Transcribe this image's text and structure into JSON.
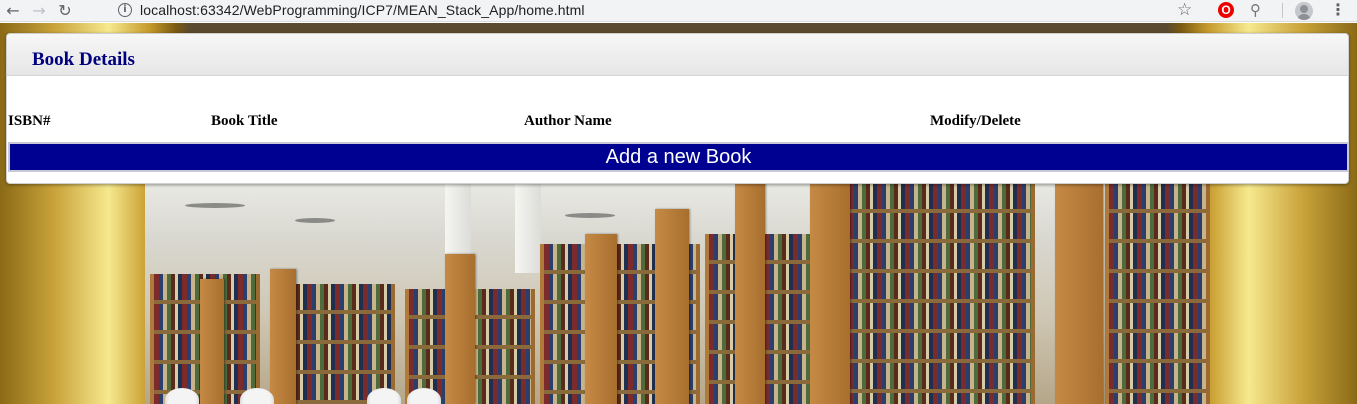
{
  "browser": {
    "url": "localhost:63342/WebProgramming/ICP7/MEAN_Stack_App/home.html",
    "icons": [
      "back-icon",
      "forward-icon",
      "reload-icon",
      "info-icon",
      "bookmark-star-icon",
      "opera-extension-icon",
      "extension-icon",
      "profile-avatar-icon",
      "menu-icon"
    ],
    "glyphs": {
      "back": "←",
      "forward": "→",
      "reload": "↻",
      "info": "i",
      "star": "☆",
      "opera": "O",
      "ext": "⚲",
      "menu": "⋮"
    }
  },
  "panel": {
    "title": "Book Details",
    "title_color": "#00007f",
    "columns": [
      "ISBN#",
      "Book Title",
      "Author Name",
      "Modify/Delete"
    ],
    "add_button_label": "Add a new Book",
    "add_button_color": "#000091"
  }
}
